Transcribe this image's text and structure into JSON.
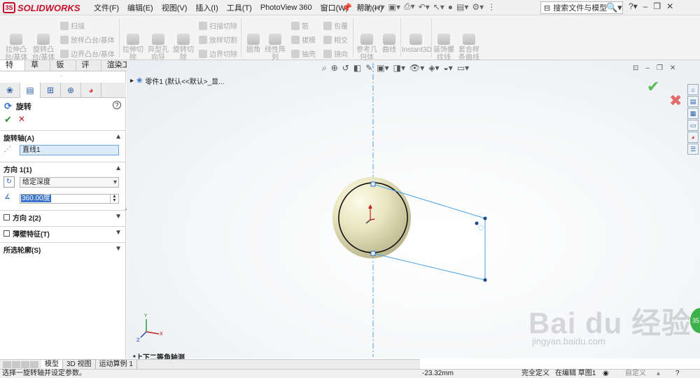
{
  "app": {
    "logo_text": "SOLIDWORKS",
    "logo_mark": "3S"
  },
  "menu": [
    "文件(F)",
    "编辑(E)",
    "视图(V)",
    "插入(I)",
    "工具(T)",
    "PhotoView 360",
    "窗口(W)",
    "帮助(H)"
  ],
  "search": {
    "placeholder": "搜索文件与模型"
  },
  "ribbon": {
    "extrude_boss": "拉伸凸\n台/基体",
    "revolve_boss": "旋转凸\n台/基体",
    "sweep": "扫描",
    "loft": "放样凸台/基体",
    "boundary": "边界凸台/基体",
    "extrude_cut": "拉伸切\n除",
    "hole_wizard": "异型孔\n向导",
    "revolve_cut": "旋转切\n除",
    "swept_cut": "扫描切除",
    "lofted_cut": "放样切割",
    "boundary_cut": "边界切除",
    "fillet": "圆角",
    "linear_pattern": "线性阵\n列",
    "rib": "筋",
    "draft": "拔模",
    "shell": "抽壳",
    "wrap": "包覆",
    "intersect": "相交",
    "mirror": "镜向",
    "ref_geometry": "参考几\n何体",
    "curves": "曲线",
    "instant3d": "Instant3D",
    "threads": "装饰螺\n纹线",
    "composite_curve": "套合样\n条曲线"
  },
  "cm_tabs": [
    "特征",
    "草图",
    "钣金",
    "评估",
    "渲染工具"
  ],
  "property_manager": {
    "title": "旋转",
    "help": "?",
    "axis_section": "旋转轴(A)",
    "axis_value": "直线1",
    "direction1_section": "方向 1(1)",
    "end_condition": "给定深度",
    "angle_value": "360.00度",
    "direction2_section": "方向 2(2)",
    "thin_feature_section": "薄壁特征(T)",
    "contours_section": "所选轮廓(S)"
  },
  "tree": {
    "part_label": "零件1  (默认<<默认>_显..."
  },
  "view_label": "*上下二等角轴测",
  "bottom_tabs": [
    "模型",
    "3D 视图",
    "运动算例 1"
  ],
  "status": {
    "message": "选择一旋转轴并设定参数。",
    "coord": "-23.32mm",
    "defined": "完全定义",
    "editing": "在编辑 草图1",
    "custom": "自定义"
  },
  "watermark": {
    "brand": "Bai du 经验",
    "url": "jingyan.baidu.com"
  },
  "colors": {
    "accent": "#2a6bc7",
    "brand_red": "#c8102e",
    "ok_green": "#2e8b2e",
    "cancel_red": "#c0202a",
    "sketch_blue": "#4aa3e8"
  }
}
